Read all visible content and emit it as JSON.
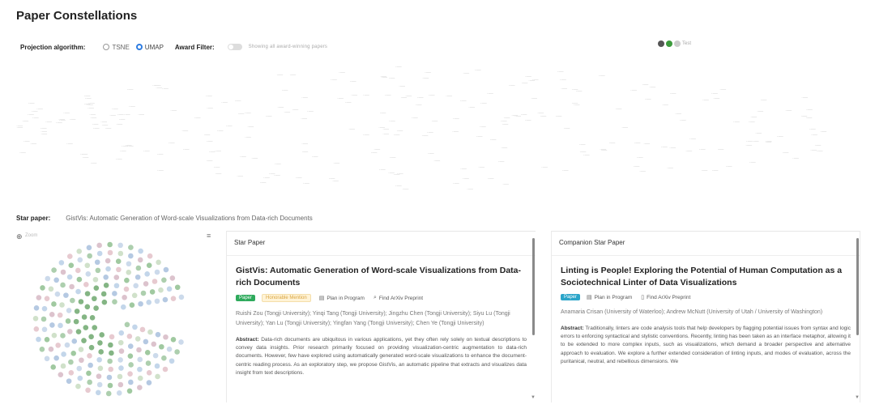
{
  "app": {
    "title": "Paper Constellations"
  },
  "controls": {
    "projection_label": "Projection algorithm:",
    "options": [
      {
        "label": "TSNE",
        "selected": false
      },
      {
        "label": "UMAP",
        "selected": true
      }
    ],
    "award_label": "Award Filter:",
    "award_desc": "Showing all award-winning papers",
    "legend": [
      {
        "label": "",
        "color": "#555555"
      },
      {
        "label": "",
        "color": "#3c9a3c"
      },
      {
        "label": "Test",
        "color": "#bbbbbb"
      }
    ]
  },
  "star_row": {
    "label": "Star paper:",
    "value": "GistVis: Automatic Generation of Word-scale Visualizations from Data-rich Documents"
  },
  "left_panel": {
    "zoom_text": "Zoom"
  },
  "star_card": {
    "header": "Star Paper",
    "title": "GistVis: Automatic Generation of Word-scale Visualizations from Data-rich Documents",
    "badge": "Paper",
    "badge_color": "#2eaa5c",
    "award": "Honorable Mention",
    "plan_label": "Plan in Program",
    "arxiv_label": "Find ArXiv Preprint",
    "authors": "Ruishi Zou (Tongji University); Yinqi Tang (Tongji University); Jingzhu Chen (Tongji University); Siyu Lu (Tongji University); Yan Lu (Tongji University); Yingfan Yang (Tongji University); Chen Ye (Tongji University)",
    "abstract_label": "Abstract:",
    "abstract": "Data-rich documents are ubiquitous in various applications, yet they often rely solely on textual descriptions to convey data insights. Prior research primarily focused on providing visualization-centric augmentation to data-rich documents. However, few have explored using automatically generated word-scale visualizations to enhance the document-centric reading process. As an exploratory step, we propose GistVis, an automatic pipeline that extracts and visualizes data insight from text descriptions."
  },
  "comp_card": {
    "header": "Companion Star Paper",
    "title": "Linting is People! Exploring the Potential of Human Computation as a Sociotechnical Linter of Data Visualizations",
    "badge": "Paper",
    "badge_color": "#2ba5c9",
    "plan_label": "Plan in Program",
    "arxiv_label": "Find ArXiv Preprint",
    "authors": "Anamaria Crisan (University of Waterloo); Andrew McNutt (University of Utah / University of Washington)",
    "abstract_label": "Abstract:",
    "abstract": "Traditionally, linters are code analysis tools that help developers by flagging potential issues from syntax and logic errors to enforcing syntactical and stylistic conventions. Recently, linting has been taken as an interface metaphor, allowing it to be extended to more complex inputs, such as visualizations, which demand a broader perspective and alternative approach to evaluation. We explore a further extended consideration of linting inputs, and modes of evaluation, across the puritanical, neutral, and rebellious dimensions. We"
  }
}
